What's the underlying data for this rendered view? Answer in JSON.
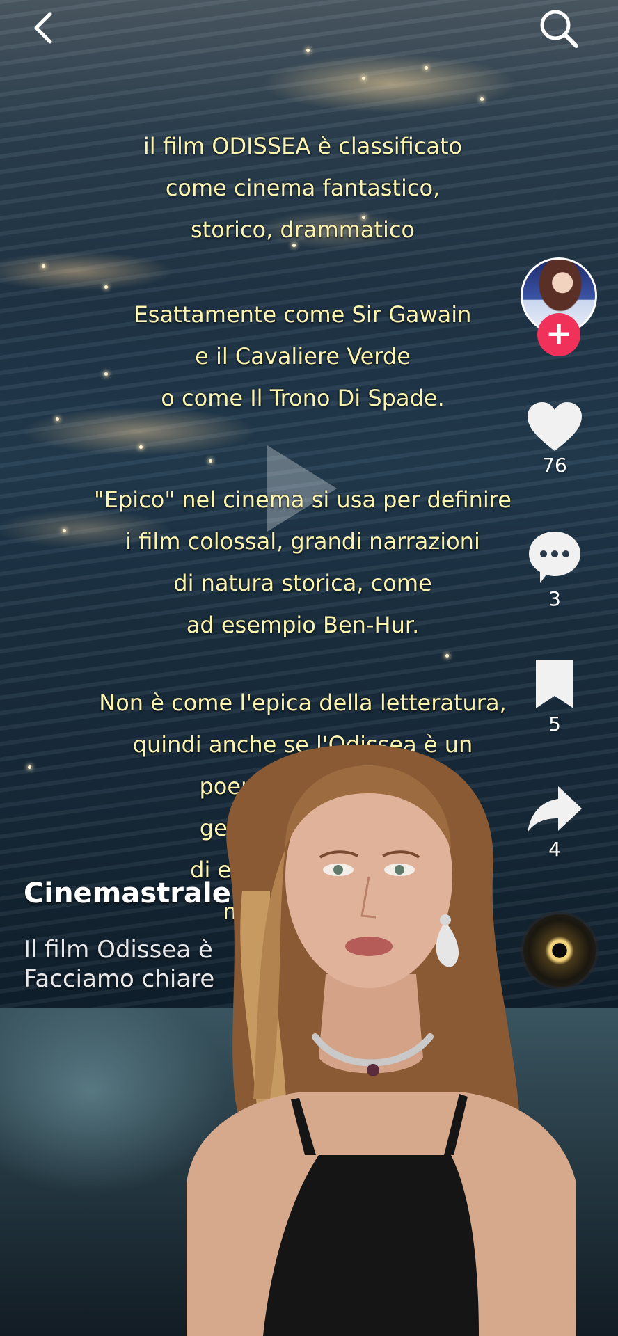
{
  "caption": {
    "block1": [
      "il film ODISSEA è classificato",
      "come cinema fantastico,",
      "storico, drammatico"
    ],
    "block2": [
      "Esattamente come Sir Gawain",
      "e il Cavaliere Verde",
      "o come Il Trono Di Spade."
    ],
    "block3": [
      "\"Epico\" nel cinema si usa per definire",
      "i film colossal, grandi narrazioni",
      "di natura storica, come",
      "ad esempio Ben-Hur."
    ],
    "block4": [
      "Non è come l'epica della letteratura,",
      "quindi anche se l'Odissea è un",
      "poema epi          rtra nel",
      "genere fan           esenza",
      "di elementi f           ciclopi,",
      "mostri ma                 ica."
    ]
  },
  "actions": {
    "likes": "76",
    "comments": "3",
    "saves": "5",
    "shares": "4",
    "follow_symbol": "+"
  },
  "post": {
    "creator_name": "Cinemastrale",
    "description_lines": [
      "Il film Odissea è",
      "Facciamo chiare"
    ]
  },
  "icons": {
    "back": "chevron-left-icon",
    "search": "search-icon",
    "like": "heart-icon",
    "comment": "comment-icon",
    "save": "bookmark-icon",
    "share": "share-arrow-icon",
    "play": "play-icon"
  },
  "colors": {
    "caption_text": "#fbf3b0",
    "follow_accent": "#f0315a",
    "icon": "#ffffff"
  }
}
